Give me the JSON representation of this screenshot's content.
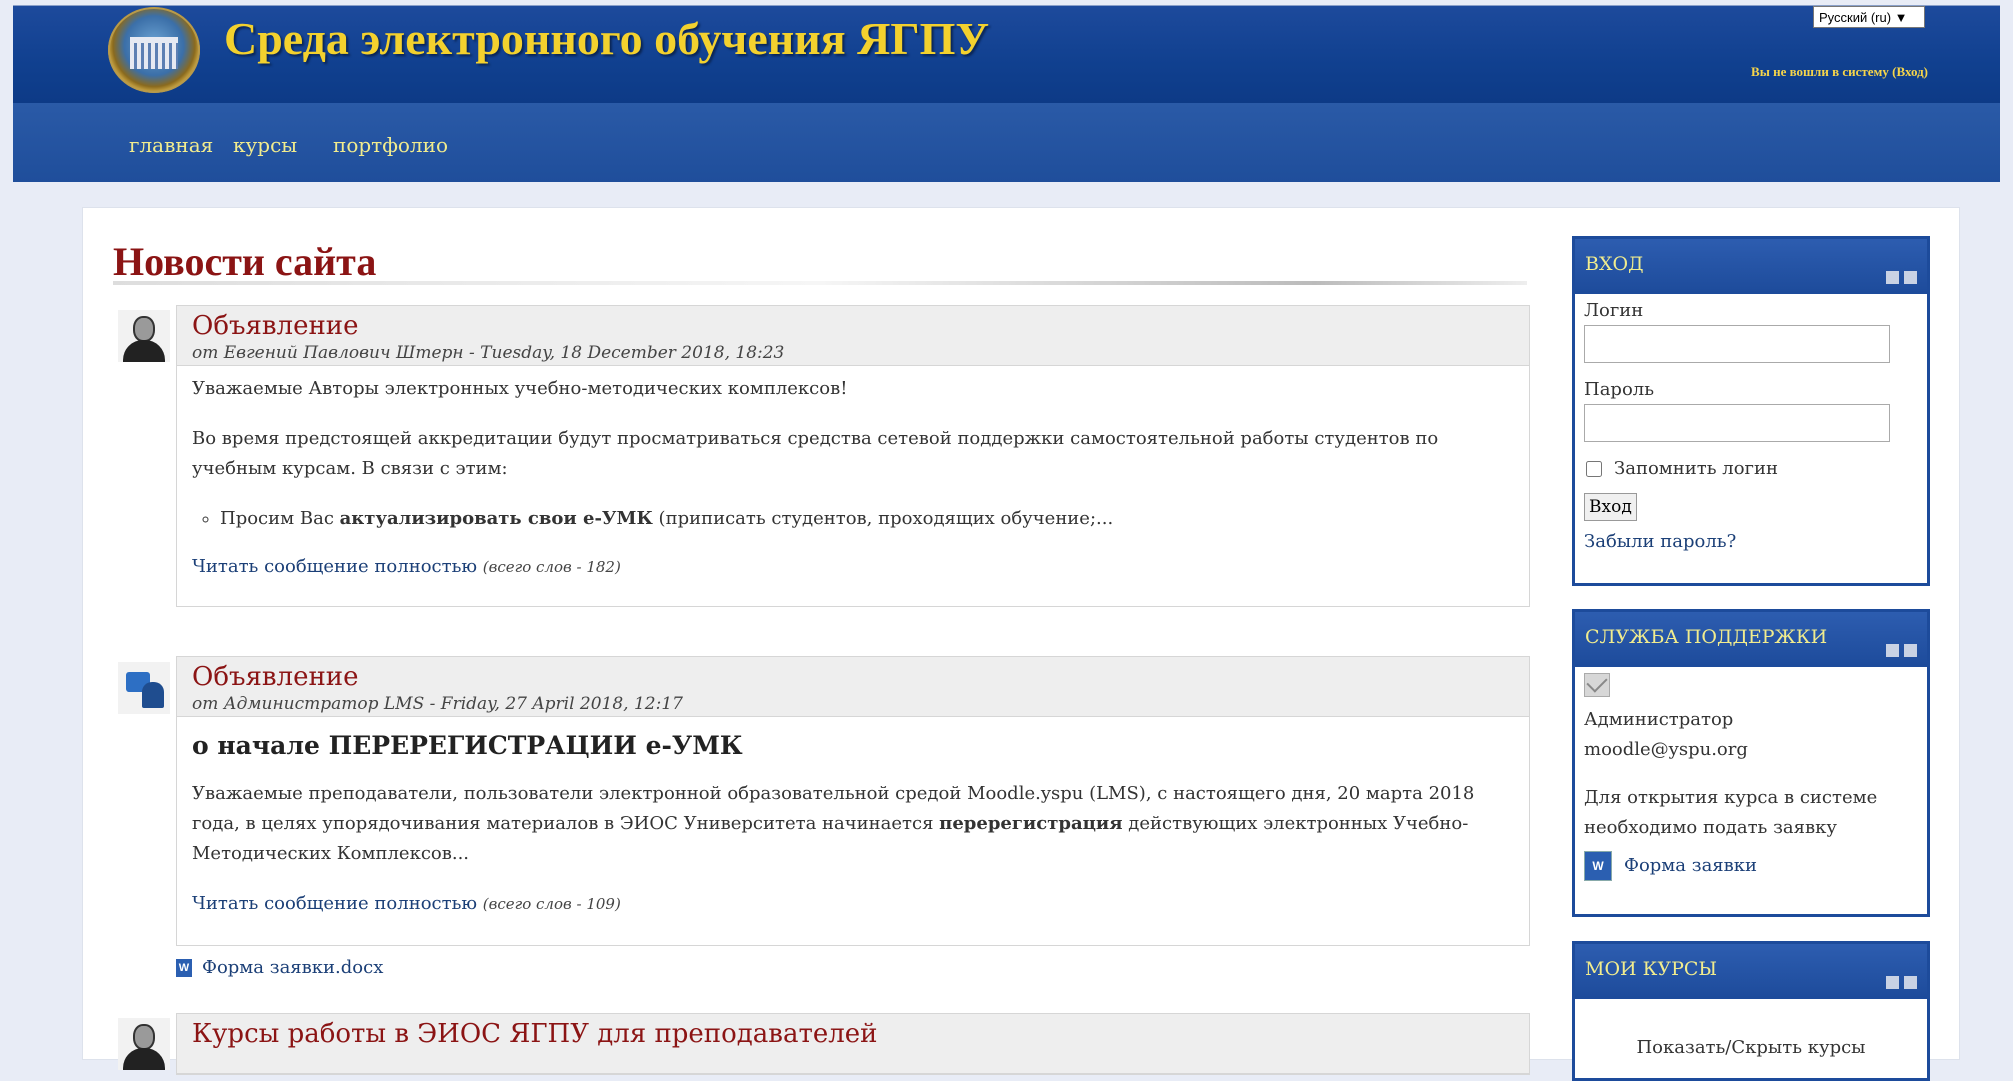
{
  "header": {
    "site_title": "Среда электронного обучения ЯГПУ",
    "language": "Русский (ru) ▼",
    "login_status": "Вы не вошли в систему (Вход)"
  },
  "nav": {
    "items": [
      "главная",
      "курсы",
      "портфолио"
    ]
  },
  "main": {
    "heading": "Новости сайта",
    "posts": [
      {
        "subject": "Объявление",
        "byline": "от Евгений Павлович Штерн - Tuesday, 18 December 2018, 18:23",
        "p1": "Уважаемые Авторы электронных учебно-методических комплексов!",
        "p2": "Во время предстоящей аккредитации будут просматриваться средства сетевой поддержки самостоятельной работы студентов по  учебным курсам. В связи с этим:",
        "li_pre": "Просим Вас ",
        "li_bold": "актуализировать  свои е-УМК",
        "li_post": "  (приписать студентов, проходящих обучение;...",
        "read_more": "Читать сообщение полностью",
        "word_count": "(всего слов - 182)"
      },
      {
        "subject": "Объявление",
        "byline": "от Администратор LMS - Friday, 27 April 2018, 12:17",
        "title": "о начале ПЕРЕРЕГИСТРАЦИИ е-УМК",
        "p1_pre": "Уважаемые преподаватели, пользователи электронной образовательной средой Moodle.yspu (LMS), с настоящего дня, 20 марта 2018 года, в целях упорядочивания материалов в ЭИОС Университета начинается ",
        "p1_bold": "перерегистрация",
        "p1_post": " действующих электронных Учебно-Методических Комплексов...",
        "read_more": "Читать сообщение полностью",
        "word_count": "(всего слов - 109)",
        "attachment": "Форма заявки.docx",
        "attachment_icon": "W"
      },
      {
        "subject": "Курсы работы в ЭИОС ЯГПУ для преподавателей"
      }
    ]
  },
  "login_block": {
    "header": "ВХОД",
    "login_label": "Логин",
    "password_label": "Пароль",
    "remember": "Запомнить логин",
    "submit": "Вход",
    "forgot": "Забыли пароль?"
  },
  "support_block": {
    "header": "СЛУЖБА ПОДДЕРЖКИ",
    "name": "Администратор",
    "email": "moodle@yspu.org",
    "text": "Для открытия курса в системе необходимо подать заявку",
    "form_link": "Форма заявки",
    "doc_icon": "W"
  },
  "courses_block": {
    "header": "МОИ КУРСЫ",
    "toggle": "Показать/Скрыть курсы"
  },
  "colors": {
    "header_blue": "#10408f",
    "nav_blue": "#1f4e9b",
    "title_yellow": "#f3d12e",
    "heading_red": "#8b1414",
    "link_blue": "#1b3f77"
  }
}
